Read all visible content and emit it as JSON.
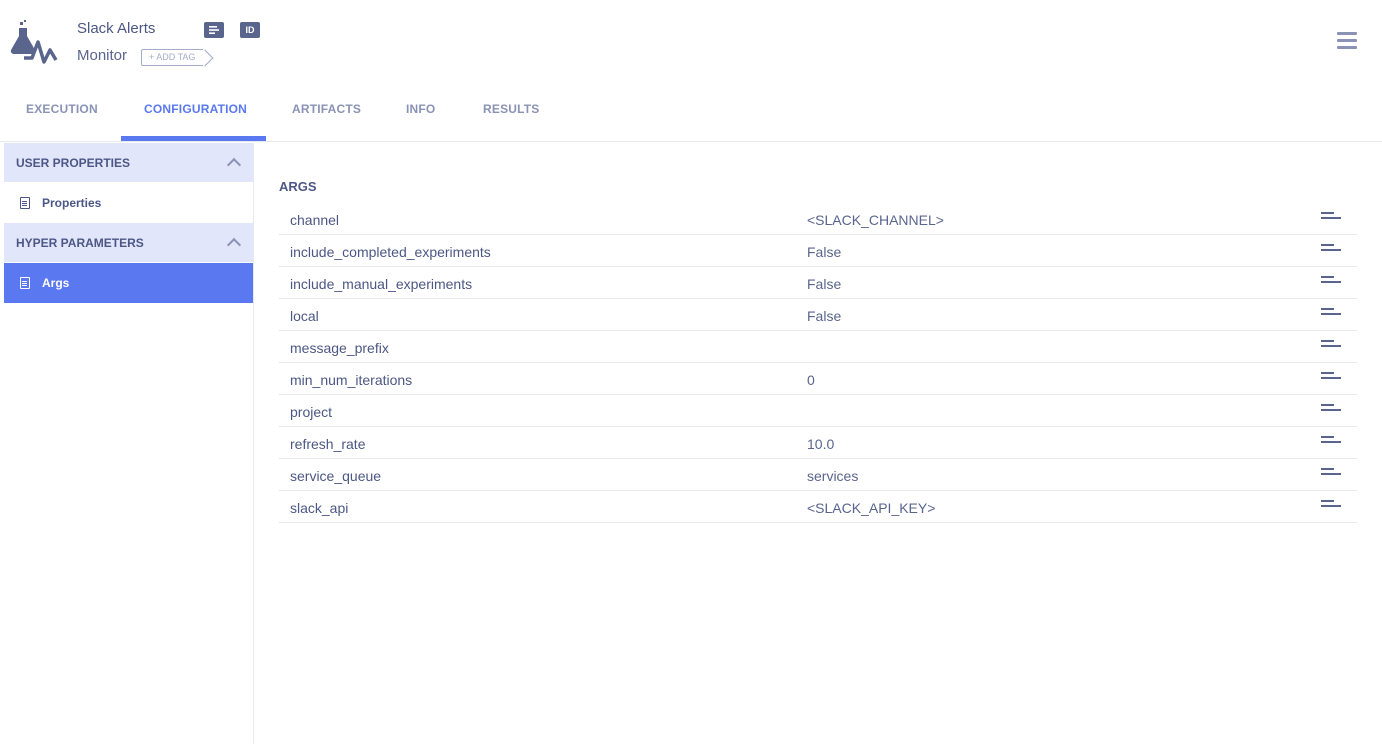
{
  "header": {
    "title": "Slack Alerts",
    "subtitle": "Monitor",
    "add_tag_label": "+ ADD TAG",
    "id_badge": "ID",
    "icons": {
      "logo": "experiment-flask-icon",
      "description": "description-icon",
      "id": "id-icon",
      "menu": "hamburger-menu-icon"
    }
  },
  "tabs": [
    {
      "label": "EXECUTION",
      "active": false
    },
    {
      "label": "CONFIGURATION",
      "active": true
    },
    {
      "label": "ARTIFACTS",
      "active": false
    },
    {
      "label": "INFO",
      "active": false
    },
    {
      "label": "RESULTS",
      "active": false
    }
  ],
  "sidebar": {
    "sections": [
      {
        "title": "USER PROPERTIES",
        "expanded": true,
        "items": [
          {
            "label": "Properties",
            "selected": false
          }
        ]
      },
      {
        "title": "HYPER PARAMETERS",
        "expanded": true,
        "items": [
          {
            "label": "Args",
            "selected": true
          }
        ]
      }
    ]
  },
  "main": {
    "section_title": "ARGS",
    "rows": [
      {
        "key": "channel",
        "value": "<SLACK_CHANNEL>"
      },
      {
        "key": "include_completed_experiments",
        "value": "False"
      },
      {
        "key": "include_manual_experiments",
        "value": "False"
      },
      {
        "key": "local",
        "value": "False"
      },
      {
        "key": "message_prefix",
        "value": ""
      },
      {
        "key": "min_num_iterations",
        "value": "0"
      },
      {
        "key": "project",
        "value": ""
      },
      {
        "key": "refresh_rate",
        "value": "10.0"
      },
      {
        "key": "service_queue",
        "value": "services"
      },
      {
        "key": "slack_api",
        "value": "<SLACK_API_KEY>"
      }
    ]
  },
  "colors": {
    "accent": "#5a78f0",
    "text": "#4c5785",
    "muted": "#8a93b5",
    "section_bg": "#e2e6fb"
  }
}
